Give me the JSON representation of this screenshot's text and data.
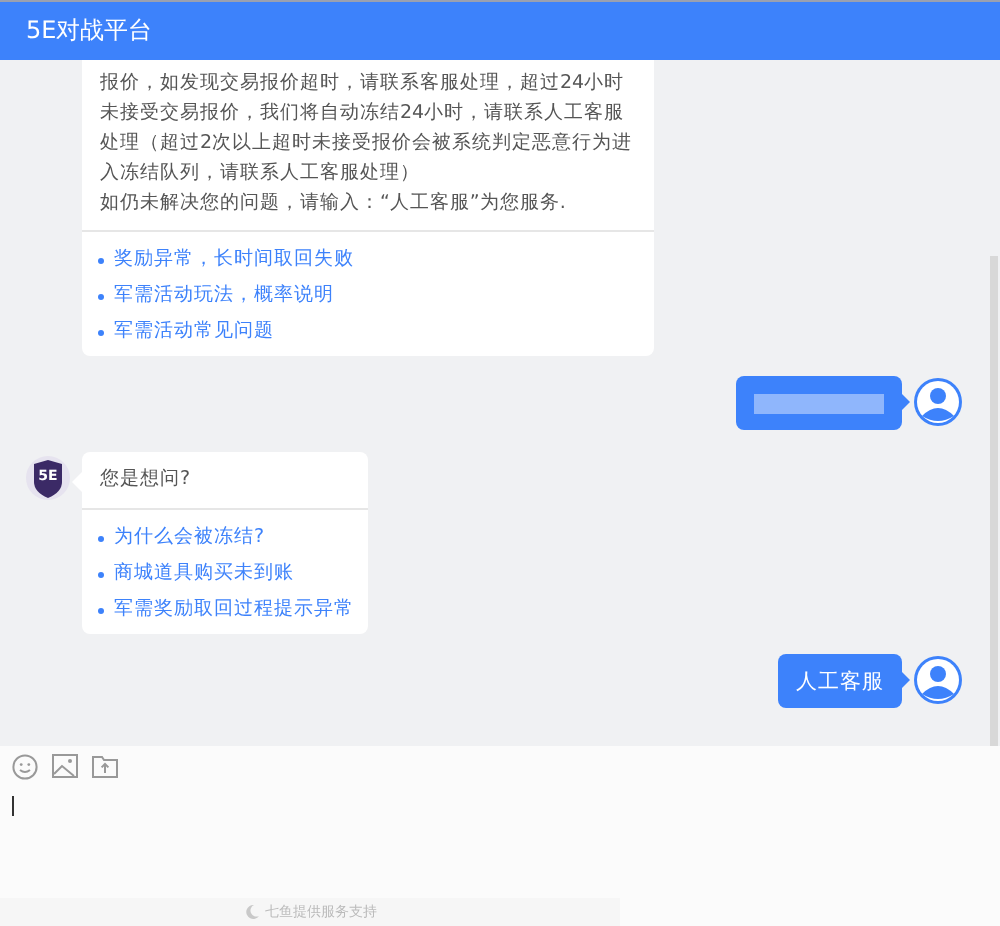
{
  "window": {
    "title": "5E对战平台"
  },
  "messages": [
    {
      "kind": "bot",
      "text": "报价，如发现交易报价超时，请联系客服处理，超过24小时未接受交易报价，我们将自动冻结24小时，请联系人工客服处理（超过2次以上超时未接受报价会被系统判定恶意行为进入冻结队列，请联系人工客服处理）",
      "note": "如仍未解决您的问题，请输入：“人工客服”为您服务.",
      "links": [
        "奖励异常，长时间取回失败",
        "军需活动玩法，概率说明",
        "军需活动常见问题"
      ]
    },
    {
      "kind": "user_blurred"
    },
    {
      "kind": "bot",
      "avatar": "5E",
      "text": "您是想问?",
      "links": [
        "为什么会被冻结?",
        "商城道具购买未到账",
        "军需奖励取回过程提示异常"
      ]
    },
    {
      "kind": "user",
      "text": "人工客服"
    }
  ],
  "composer": {
    "footer": "七鱼提供服务支持"
  }
}
